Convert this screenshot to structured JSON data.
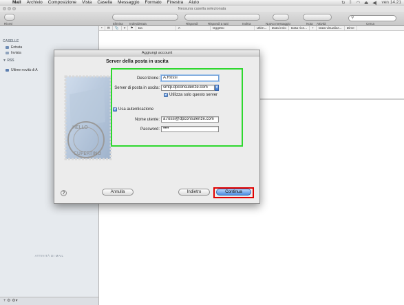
{
  "menubar": {
    "app": "Mail",
    "items": [
      "Archivio",
      "Composizione",
      "Vista",
      "Casella",
      "Messaggio",
      "Formato",
      "Finestra",
      "Aiuto"
    ],
    "clock": "ven 14.21",
    "status_icons": [
      "sync-icon",
      "bluetooth-icon",
      "wifi-icon",
      "eject-icon",
      "volume-icon"
    ]
  },
  "window": {
    "title": "Nessuna casella selezionata"
  },
  "toolbar": {
    "ricevi": "Ricevi",
    "elimina": "Elimina",
    "indesiderata": "Indesiderata",
    "rispondi": "Rispondi",
    "rispondi_tutti": "Rispondi a tutti",
    "inoltra": "Inoltra",
    "nuovo": "Nuovo messaggio",
    "nota": "Nota",
    "attivita": "Attività",
    "cerca": "Cerca"
  },
  "columns": [
    "•",
    "✉",
    "📎",
    "#",
    "⚑",
    "Da",
    "A",
    "Oggetto",
    "Ultim...",
    "Data invio",
    "Data rice...",
    "+",
    "Data visualizz...",
    "Dime"
  ],
  "sidebar": {
    "caselle_header": "CASELLE",
    "items": [
      {
        "label": "Entrata",
        "icon": "inbox-icon"
      },
      {
        "label": "Inviata",
        "icon": "paper-plane-icon"
      }
    ],
    "rss_header": "RSS",
    "rss_items": [
      {
        "label": "Ultime novità di A",
        "icon": "rss-icon"
      }
    ],
    "activity": "ATTIVITÀ DI MAIL",
    "bottom_buttons": "+  ⚙  ⚙▾"
  },
  "dialog": {
    "title": "Aggiungi account",
    "section_title": "Server della posta in uscita",
    "descrizione_label": "Descrizione:",
    "descrizione_value": "A.Rossi",
    "server_label": "Server di posta in uscita:",
    "server_value": "smtp.dpconsulenze.com",
    "solo_server_label": "Utilizza solo questo server",
    "usa_auth_label": "Usa autenticazione",
    "nome_utente_label": "Nome utente:",
    "nome_utente_value": "a.rossi@dpconsulenze.com",
    "password_label": "Password:",
    "password_value": "••••",
    "stamp_text": "HELLO FROM CUPERTINO",
    "help": "?",
    "annulla": "Annulla",
    "indietro": "Indietro",
    "continua": "Continua",
    "highlight_color": "#2ed82e",
    "red_box_color": "#e00000"
  }
}
